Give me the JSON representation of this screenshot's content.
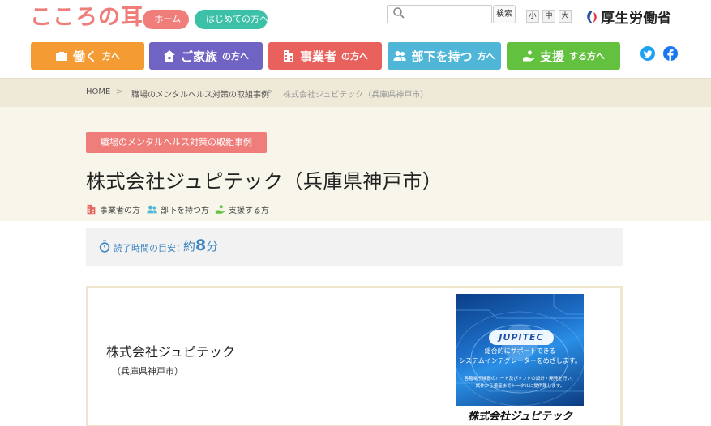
{
  "header": {
    "logo": "こころの耳",
    "home_label": "ホーム",
    "first_time_label": "はじめての方へ",
    "search_button": "検索",
    "font_small": "小",
    "font_medium": "中",
    "font_large": "大",
    "ministry": "厚生労働省"
  },
  "nav": {
    "work_main": "働く",
    "work_suffix": "方へ",
    "family_main": "ご家族",
    "family_suffix": "の方へ",
    "biz_main": "事業者",
    "biz_suffix": "の方へ",
    "boss_main": "部下を持つ",
    "boss_suffix": "方へ",
    "support_main": "支援",
    "support_suffix": "する方へ"
  },
  "breadcrumb": {
    "home": "HOME",
    "sep": ">",
    "category": "職場のメンタルヘルス対策の取組事例",
    "current": "株式会社ジュピテック（兵庫県神戸市）"
  },
  "hero": {
    "category_badge": "職場のメンタルヘルス対策の取組事例",
    "title": "株式会社ジュピテック（兵庫県神戸市）",
    "tags": [
      "事業者の方",
      "部下を持つ方",
      "支援する方"
    ]
  },
  "reading": {
    "label": "読了時間の目安：",
    "prefix": "約",
    "minutes": "8",
    "unit": "分"
  },
  "company": {
    "name": "株式会社ジュピテック",
    "location": "（兵庫県神戸市）"
  },
  "ad": {
    "logo": "JUPITEC",
    "line1": "総合的にサポートできる",
    "line2": "システムインテグレーターをめざします。",
    "small1": "各種電子機器のハード及びソフトの設計・開発を行い、",
    "small2": "試作から量産までトータルに提供致します。",
    "caption": "株式会社ジュピテック"
  },
  "colors": {
    "logo": "#ef7d7a",
    "work": "#f59b34",
    "family": "#6f63c4",
    "business": "#e8615c",
    "boss": "#4fb6d8",
    "support": "#62c13e",
    "reading_text": "#3e86c2"
  }
}
